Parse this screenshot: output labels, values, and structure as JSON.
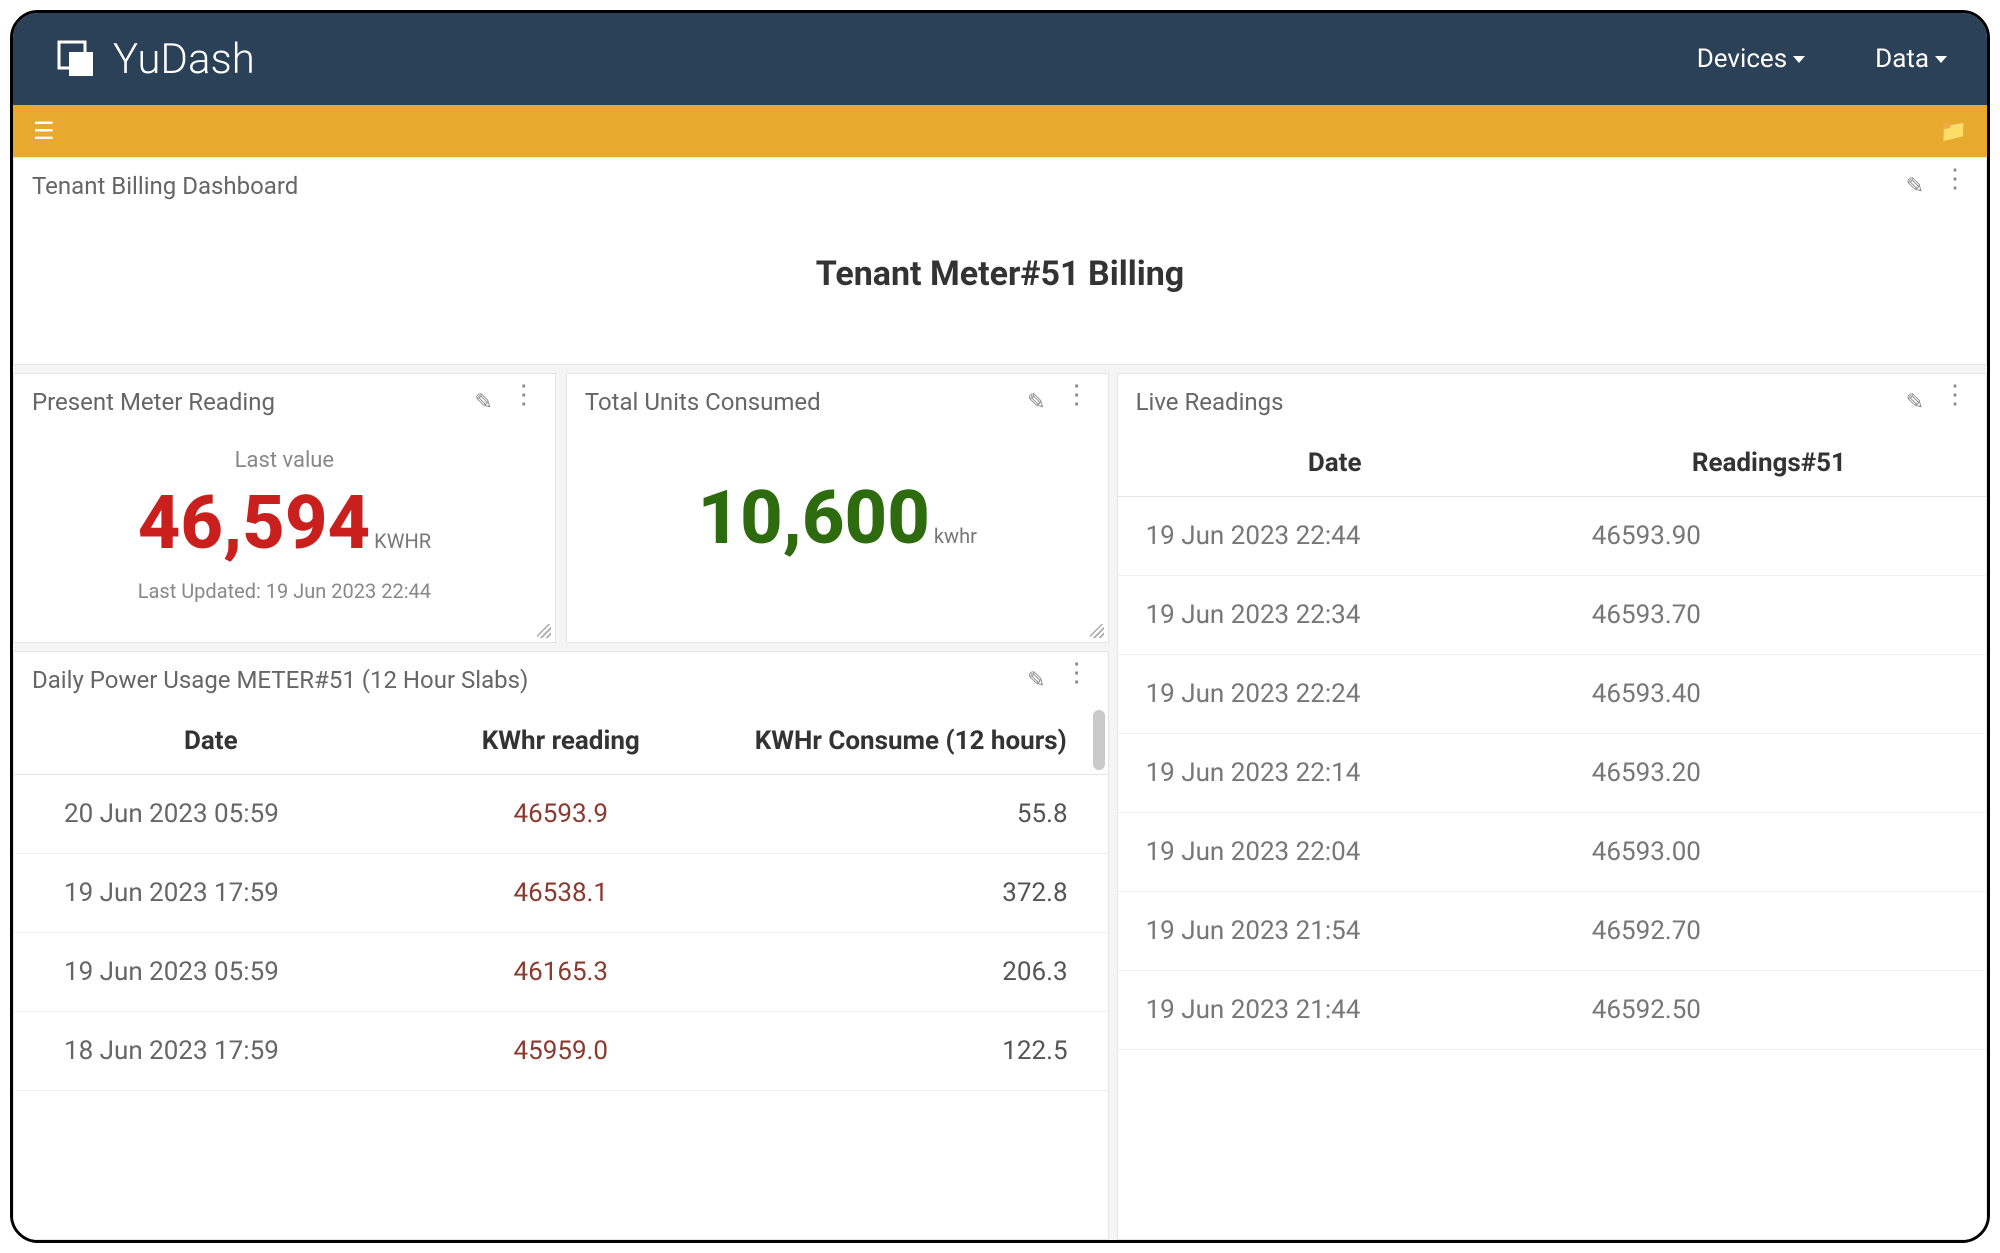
{
  "brand": {
    "name": "YuDash"
  },
  "nav": {
    "devices": "Devices",
    "data": "Data"
  },
  "dashboard_title": "Tenant Billing Dashboard",
  "main_heading": "Tenant Meter#51 Billing",
  "present_reading": {
    "title": "Present Meter Reading",
    "subtitle": "Last value",
    "value": "46,594",
    "unit": "KWHR",
    "last_updated": "Last Updated: 19 Jun 2023 22:44"
  },
  "total_units": {
    "title": "Total Units Consumed",
    "value": "10,600",
    "unit": "kwhr"
  },
  "daily_usage": {
    "title": "Daily Power Usage METER#51 (12 Hour Slabs)",
    "columns": {
      "date": "Date",
      "reading": "KWhr reading",
      "consume": "KWHr Consume (12 hours)"
    },
    "rows": [
      {
        "date": "20 Jun 2023 05:59",
        "reading": "46593.9",
        "consume": "55.8"
      },
      {
        "date": "19 Jun 2023 17:59",
        "reading": "46538.1",
        "consume": "372.8"
      },
      {
        "date": "19 Jun 2023 05:59",
        "reading": "46165.3",
        "consume": "206.3"
      },
      {
        "date": "18 Jun 2023 17:59",
        "reading": "45959.0",
        "consume": "122.5"
      }
    ]
  },
  "live_readings": {
    "title": "Live Readings",
    "columns": {
      "date": "Date",
      "reading": "Readings#51"
    },
    "rows": [
      {
        "date": "19 Jun 2023 22:44",
        "reading": "46593.90"
      },
      {
        "date": "19 Jun 2023 22:34",
        "reading": "46593.70"
      },
      {
        "date": "19 Jun 2023 22:24",
        "reading": "46593.40"
      },
      {
        "date": "19 Jun 2023 22:14",
        "reading": "46593.20"
      },
      {
        "date": "19 Jun 2023 22:04",
        "reading": "46593.00"
      },
      {
        "date": "19 Jun 2023 21:54",
        "reading": "46592.70"
      },
      {
        "date": "19 Jun 2023 21:44",
        "reading": "46592.50"
      }
    ]
  }
}
